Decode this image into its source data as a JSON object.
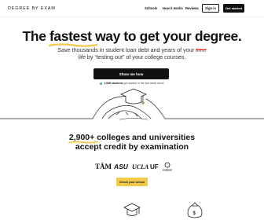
{
  "nav": {
    "logo": "DEGREE BY EXAM",
    "links": [
      "Schools",
      "How it works",
      "Reviews"
    ],
    "signin_label": "Sign in",
    "started_label": "Get started"
  },
  "hero": {
    "headline_pre": "The ",
    "headline_accent": "fastest",
    "headline_post": " way to get your degree.",
    "sub_line1_pre": "Save thousands in student loan debt and years of your ",
    "sub_line1_strike": "time",
    "sub_line2_italic": "life",
    "sub_line2_post": " by “testing out” of your college courses.",
    "cta_label": "Show me how",
    "social_bold": "1,946 students",
    "social_rest": " got started in the last week alone"
  },
  "colleges": {
    "title_accent": "2,900+",
    "title_rest": " colleges and universities",
    "title_line2": "accept credit by examination",
    "cta_label": "Check your school",
    "logo_texts": [
      "TĀM",
      "ASU",
      "UCLA",
      "UF",
      "PURDUE"
    ]
  },
  "icons": [
    "graduation-cap-illustration",
    "mortarboard-icon",
    "money-bag-icon"
  ],
  "colors": {
    "accent_yellow": "#f2c94c",
    "strike_red": "#d72b2b",
    "dark": "#111111",
    "online_green": "#37c26a"
  }
}
